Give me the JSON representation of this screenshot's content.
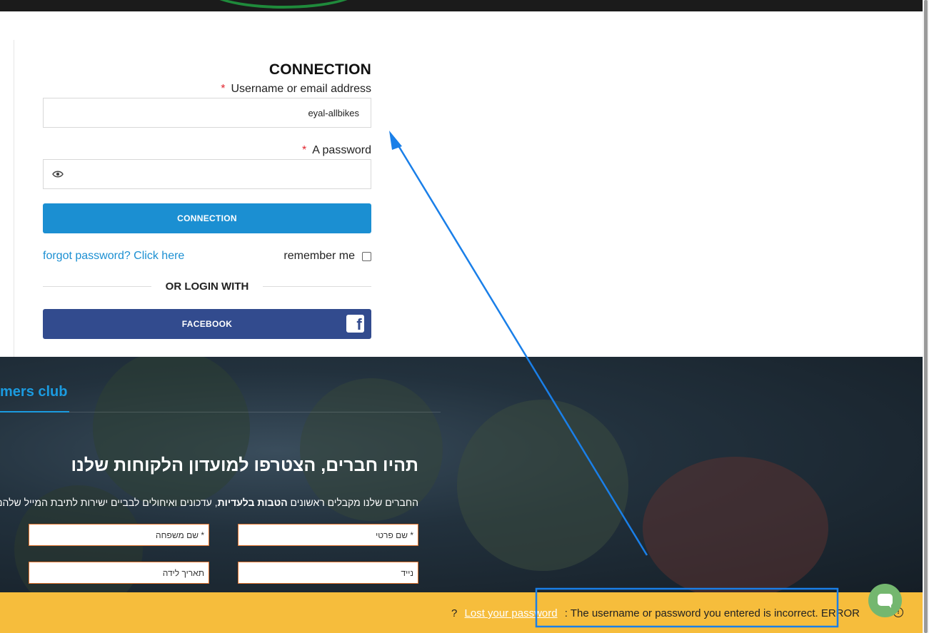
{
  "login": {
    "title": "CONNECTION",
    "username_label": "Username or email address",
    "username_value": "eyal-allbikes",
    "password_label": "A password",
    "required_mark": "*",
    "connect_button": "CONNECTION",
    "forgot_link": "forgot password? Click here",
    "remember_label": "remember me",
    "or_login_with": "OR LOGIN WITH",
    "facebook_button": "FACEBOOK"
  },
  "club": {
    "title_fragment": "mers club",
    "heading": "תהיו חברים, הצטרפו למועדון הלקוחות שלנו",
    "subtext_before": "החברים שלנו מקבלים ראשונים ",
    "subtext_bold": "הטבות בלעדיות",
    "subtext_after": ", עדכונים ואיחולים לבביים ישירות לתיבת המייל שלהם",
    "fields": {
      "first_name": "* שם פרטי",
      "last_name": "* שם משפחה",
      "mobile": "נייד",
      "birth_date": "תאריך לידה"
    }
  },
  "notice": {
    "error_label": "ERROR",
    "message": ": The username or password you entered is incorrect.",
    "lost_link": "Lost your password",
    "question_mark": "?"
  },
  "colors": {
    "accent_blue": "#1b8fd2",
    "facebook_blue": "#324b8e",
    "notice_yellow": "#f6bd3c",
    "annotation_blue": "#1a7fe8"
  }
}
